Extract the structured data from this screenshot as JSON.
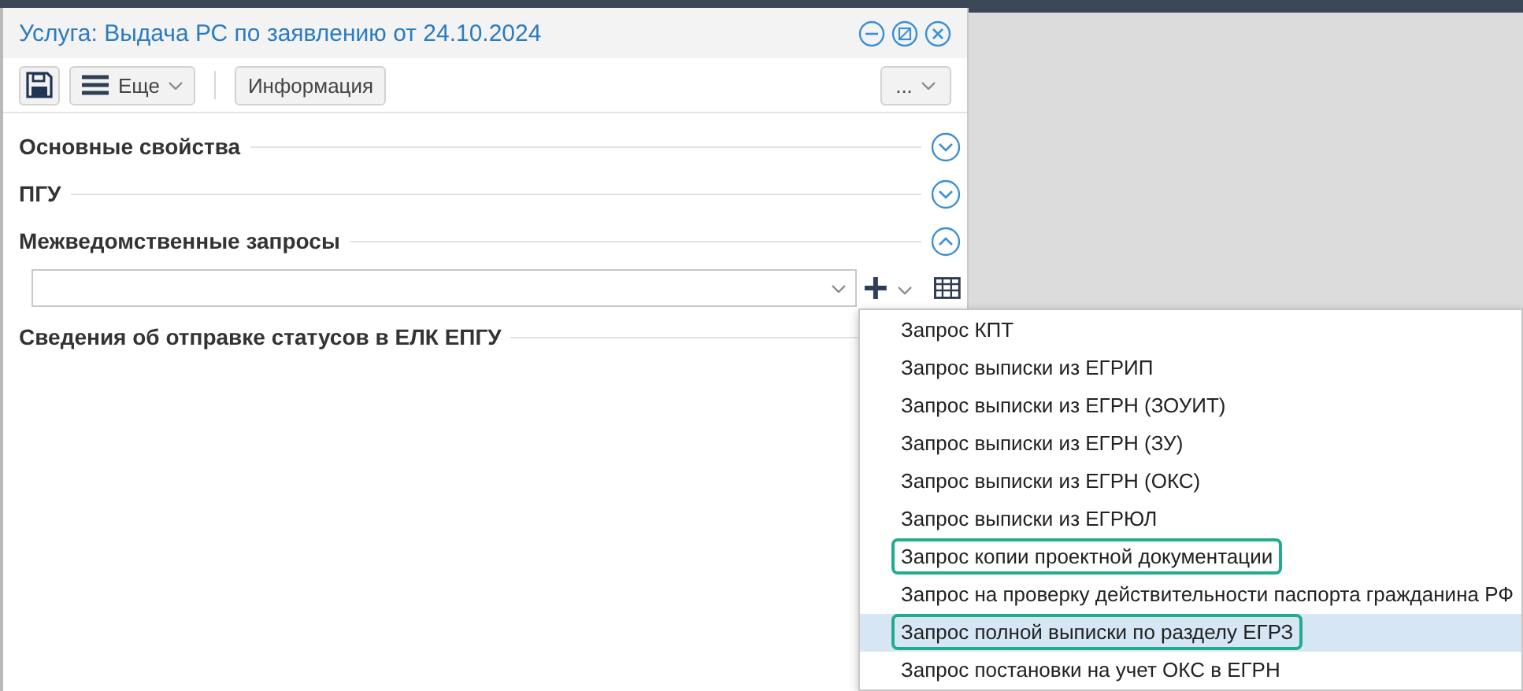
{
  "window": {
    "title": "Услуга: Выдача РС по заявлению от 24.10.2024"
  },
  "toolbar": {
    "more_button": "Еще",
    "info_button": "Информация",
    "overflow_button": "..."
  },
  "sections": [
    {
      "title": "Основные свойства",
      "expanded": false
    },
    {
      "title": "ПГУ",
      "expanded": false
    },
    {
      "title": "Межведомственные запросы",
      "expanded": true
    },
    {
      "title": "Сведения об отправке статусов в ЕЛК ЕПГУ"
    }
  ],
  "dropdown_menu": {
    "items": [
      {
        "label": "Запрос КПТ",
        "selected": false,
        "highlighted": false
      },
      {
        "label": "Запрос выписки из ЕГРИП",
        "selected": false,
        "highlighted": false
      },
      {
        "label": "Запрос выписки из ЕГРН (ЗОУИТ)",
        "selected": false,
        "highlighted": false
      },
      {
        "label": "Запрос выписки из ЕГРН (ЗУ)",
        "selected": false,
        "highlighted": false
      },
      {
        "label": "Запрос выписки из ЕГРН (ОКС)",
        "selected": false,
        "highlighted": false
      },
      {
        "label": "Запрос выписки из ЕГРЮЛ",
        "selected": false,
        "highlighted": false
      },
      {
        "label": "Запрос копии проектной документации",
        "selected": false,
        "highlighted": true
      },
      {
        "label": "Запрос на проверку действительности паспорта гражданина РФ",
        "selected": false,
        "highlighted": false
      },
      {
        "label": "Запрос полной выписки по разделу ЕГРЗ",
        "selected": true,
        "highlighted": true
      },
      {
        "label": "Запрос постановки на учет ОКС в ЕГРН",
        "selected": false,
        "highlighted": false
      }
    ]
  }
}
